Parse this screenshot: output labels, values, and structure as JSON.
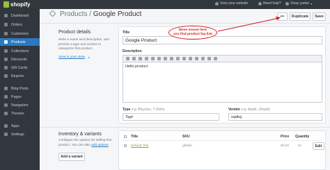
{
  "topbar": {
    "logo": "shopify",
    "view_site": "View your website",
    "help": "Need help?",
    "user": "Vinay yadav"
  },
  "sidebar": {
    "items": [
      {
        "label": "Dashboard",
        "icon": "dashboard-icon"
      },
      {
        "label": "Orders",
        "icon": "orders-icon"
      },
      {
        "label": "Customers",
        "icon": "customers-icon"
      },
      {
        "label": "Products",
        "icon": "products-icon"
      },
      {
        "label": "Collections",
        "icon": "collections-icon"
      },
      {
        "label": "Discounts",
        "icon": "discounts-icon"
      },
      {
        "label": "Gift Cards",
        "icon": "gift-cards-icon"
      },
      {
        "label": "Reports",
        "icon": "reports-icon"
      },
      {
        "label": "Blog Posts",
        "icon": "blog-posts-icon"
      },
      {
        "label": "Pages",
        "icon": "pages-icon"
      },
      {
        "label": "Navigation",
        "icon": "navigation-icon"
      },
      {
        "label": "Themes",
        "icon": "themes-icon"
      },
      {
        "label": "Apps",
        "icon": "apps-icon"
      },
      {
        "label": "Settings",
        "icon": "settings-icon"
      }
    ],
    "active": "Products"
  },
  "header": {
    "breadcrumb_parent": "Products",
    "separator": "/",
    "title": "Google Product",
    "more_label": "•••",
    "duplicate_label": "Duplicate",
    "save_label": "Save"
  },
  "details": {
    "title": "Product details",
    "description": "Write a name and description, and provide a type and vendor to categorize this product.",
    "view_link": "View in your store"
  },
  "form": {
    "title_label": "Title",
    "title_value": "Google Product",
    "description_label": "Description",
    "description_value": "Hello product",
    "type_label": "Type",
    "type_hint": "e.g. Bicycles, T-Shirts",
    "type_value": "Tsgrt",
    "vendor_label": "Vendor",
    "vendor_hint": "e.g. Apple, Shopify",
    "vendor_value": "sxjdksj"
  },
  "annotation": {
    "line1": "Move mouse here",
    "line2": "you find product faq link",
    "color": "#d0161c"
  },
  "inventory": {
    "title": "Inventory & variants",
    "desc_prefix": "Configure the options for selling this product. You can also ",
    "desc_link": "edit options",
    "add_variant": "Add a variant",
    "columns": {
      "title": "Title",
      "sku": "SKU",
      "price": "Price",
      "qty": "Quantity"
    },
    "rows": [
      {
        "title": "Default Title",
        "sku": "ghkldo",
        "price": "80.00",
        "qty": "0x",
        "edit": "Edit"
      }
    ]
  },
  "colors": {
    "accent": "#2a7ac0",
    "sidebar": "#31373d",
    "brand_green": "#96bf48"
  }
}
